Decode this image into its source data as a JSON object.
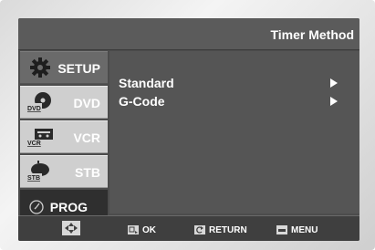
{
  "header": {
    "title": "Timer Method"
  },
  "sidebar": {
    "items": [
      {
        "label": "SETUP",
        "icon": "gear-icon"
      },
      {
        "label": "DVD",
        "icon": "dvd-icon"
      },
      {
        "label": "VCR",
        "icon": "vcr-icon"
      },
      {
        "label": "STB",
        "icon": "stb-icon"
      },
      {
        "label": "PROG",
        "icon": "clock-icon"
      }
    ],
    "icon_badges": {
      "dvd": "DVD",
      "vcr": "VCR",
      "stb": "STB"
    }
  },
  "menu": {
    "items": [
      {
        "label": "Standard",
        "arrow": "▶"
      },
      {
        "label": "G-Code",
        "arrow": "▶"
      }
    ]
  },
  "footer": {
    "hints": [
      {
        "label": "",
        "icon": "dpad-icon"
      },
      {
        "label": "OK",
        "icon": "ok-key-icon"
      },
      {
        "label": "RETURN",
        "icon": "return-key-icon"
      },
      {
        "label": "MENU",
        "icon": "menu-key-icon"
      }
    ]
  },
  "colors": {
    "screen_bg": "#4c4c4c",
    "sidebar_tab": "#cfcfcf",
    "active_tab": "#2f2f2f",
    "text": "#ffffff"
  }
}
